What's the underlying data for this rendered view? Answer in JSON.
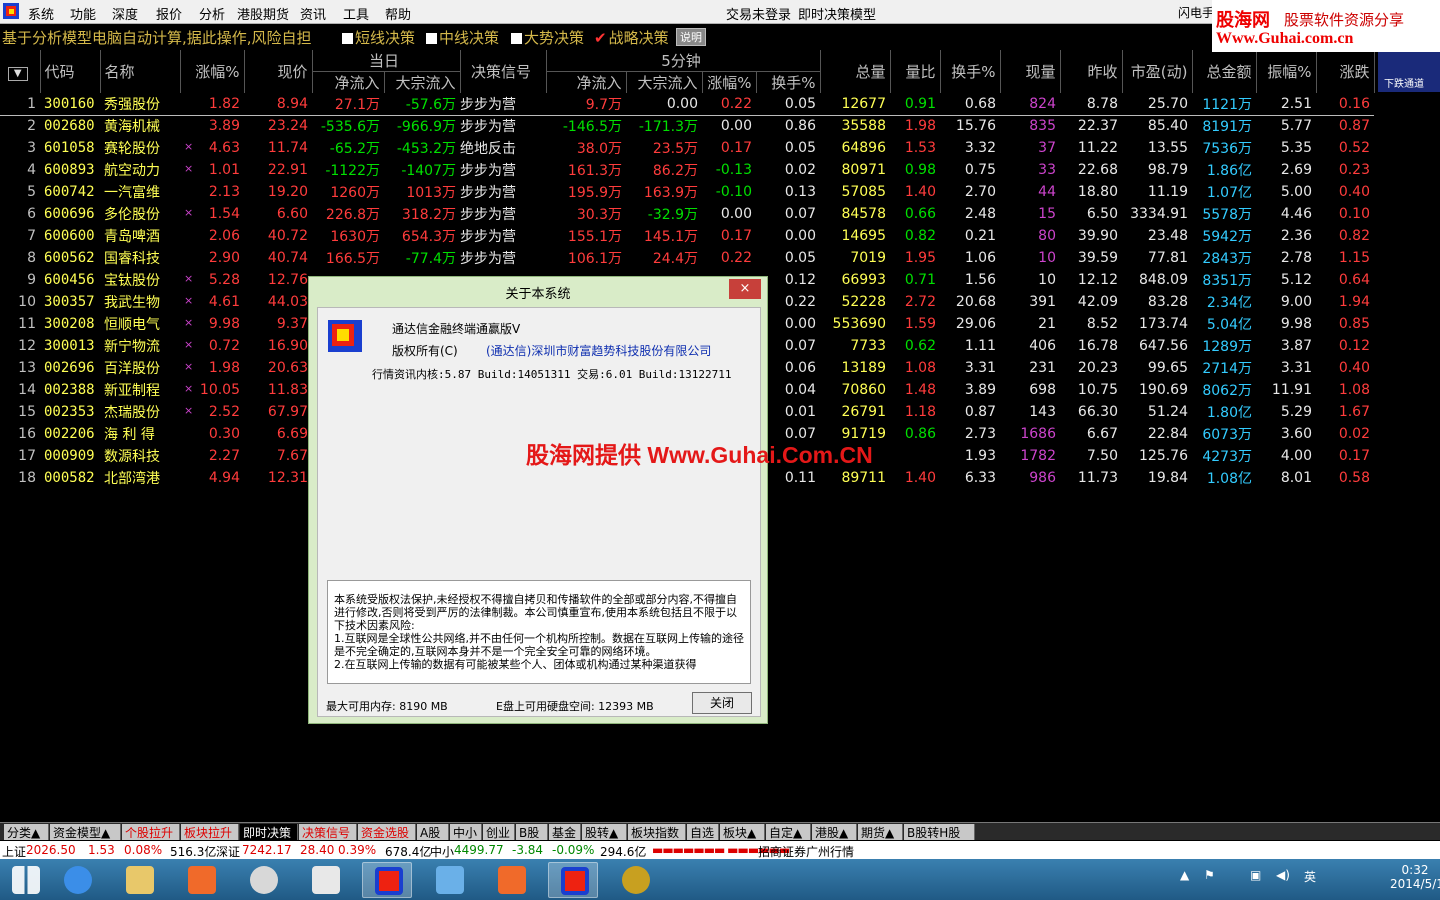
{
  "menubar": {
    "items": [
      "系统",
      "功能",
      "深度",
      "报价",
      "分析",
      "港股期货",
      "资讯",
      "工具",
      "帮助"
    ],
    "center_items": [
      "交易未登录",
      "即时决策模型"
    ],
    "right_label": "闪电手"
  },
  "brand": {
    "name": "股海网",
    "slogan": "股票软件资源分享",
    "url": "Www.Guhai.com.cn"
  },
  "subbar": {
    "info": "基于分析模型电脑自动计算,据此操作,风险自担",
    "options": [
      {
        "label": "短线决策",
        "checked": false
      },
      {
        "label": "中线决策",
        "checked": false
      },
      {
        "label": "大势决策",
        "checked": false
      },
      {
        "label": "战略决策",
        "checked": true
      }
    ],
    "help": "说明"
  },
  "drop_indicator": "下跌通道",
  "table": {
    "headers": {
      "code": "代码",
      "name": "名称",
      "chg": "涨幅%",
      "price": "现价",
      "day_group": "当日",
      "day_net": "净流入",
      "day_block": "大宗流入",
      "signal": "决策信号",
      "min5_group": "5分钟",
      "m5_net": "净流入",
      "m5_block": "大宗流入",
      "m5_chg": "涨幅%",
      "m5_turn": "换手%",
      "vol": "总量",
      "vr": "量比",
      "turn": "换手%",
      "cur": "现量",
      "prev": "昨收",
      "pe": "市盈(动)",
      "amt": "总金额",
      "amp": "振幅%",
      "up": "涨跌"
    },
    "rows": [
      {
        "i": "1",
        "code": "300160",
        "name": "秀强股份",
        "mark": "",
        "chg": "1.82",
        "price": "8.94",
        "dnet": "27.1万",
        "dblk": "-57.6万",
        "sig": "步步为营",
        "mnet": "9.7万",
        "mblk": "0.00",
        "mchg": "0.22",
        "mturn": "0.05",
        "vol": "12677",
        "vr": "0.91",
        "turn": "0.68",
        "cur": "824",
        "prev": "8.78",
        "pe": "25.70",
        "amt": "1121万",
        "amp": "2.51",
        "up": "0.16"
      },
      {
        "i": "2",
        "code": "002680",
        "name": "黄海机械",
        "mark": "",
        "chg": "3.89",
        "price": "23.24",
        "dnet": "-535.6万",
        "dblk": "-966.9万",
        "sig": "步步为营",
        "mnet": "-146.5万",
        "mblk": "-171.3万",
        "mchg": "0.00",
        "mturn": "0.86",
        "vol": "35588",
        "vr": "1.98",
        "turn": "15.76",
        "cur": "835",
        "prev": "22.37",
        "pe": "85.40",
        "amt": "8191万",
        "amp": "5.77",
        "up": "0.87"
      },
      {
        "i": "3",
        "code": "601058",
        "name": "赛轮股份",
        "mark": "×",
        "chg": "4.63",
        "price": "11.74",
        "dnet": "-65.2万",
        "dblk": "-453.2万",
        "sig": "绝地反击",
        "mnet": "38.0万",
        "mblk": "23.5万",
        "mchg": "0.17",
        "mturn": "0.05",
        "vol": "64896",
        "vr": "1.53",
        "turn": "3.32",
        "cur": "37",
        "prev": "11.22",
        "pe": "13.55",
        "amt": "7536万",
        "amp": "5.35",
        "up": "0.52"
      },
      {
        "i": "4",
        "code": "600893",
        "name": "航空动力",
        "mark": "×",
        "chg": "1.01",
        "price": "22.91",
        "dnet": "-1122万",
        "dblk": "-1407万",
        "sig": "步步为营",
        "mnet": "161.3万",
        "mblk": "86.2万",
        "mchg": "-0.13",
        "mturn": "0.02",
        "vol": "80971",
        "vr": "0.98",
        "turn": "0.75",
        "cur": "33",
        "prev": "22.68",
        "pe": "98.79",
        "amt": "1.86亿",
        "amp": "2.69",
        "up": "0.23"
      },
      {
        "i": "5",
        "code": "600742",
        "name": "一汽富维",
        "mark": "",
        "chg": "2.13",
        "price": "19.20",
        "dnet": "1260万",
        "dblk": "1013万",
        "sig": "步步为营",
        "mnet": "195.9万",
        "mblk": "163.9万",
        "mchg": "-0.10",
        "mturn": "0.13",
        "vol": "57085",
        "vr": "1.40",
        "turn": "2.70",
        "cur": "44",
        "prev": "18.80",
        "pe": "11.19",
        "amt": "1.07亿",
        "amp": "5.00",
        "up": "0.40"
      },
      {
        "i": "6",
        "code": "600696",
        "name": "多伦股份",
        "mark": "×",
        "chg": "1.54",
        "price": "6.60",
        "dnet": "226.8万",
        "dblk": "318.2万",
        "sig": "步步为营",
        "mnet": "30.3万",
        "mblk": "-32.9万",
        "mchg": "0.00",
        "mturn": "0.07",
        "vol": "84578",
        "vr": "0.66",
        "turn": "2.48",
        "cur": "15",
        "prev": "6.50",
        "pe": "3334.91",
        "amt": "5578万",
        "amp": "4.46",
        "up": "0.10"
      },
      {
        "i": "7",
        "code": "600600",
        "name": "青岛啤酒",
        "mark": "",
        "chg": "2.06",
        "price": "40.72",
        "dnet": "1630万",
        "dblk": "654.3万",
        "sig": "步步为营",
        "mnet": "155.1万",
        "mblk": "145.1万",
        "mchg": "0.17",
        "mturn": "0.00",
        "vol": "14695",
        "vr": "0.82",
        "turn": "0.21",
        "cur": "80",
        "prev": "39.90",
        "pe": "23.48",
        "amt": "5942万",
        "amp": "2.36",
        "up": "0.82"
      },
      {
        "i": "8",
        "code": "600562",
        "name": "国睿科技",
        "mark": "",
        "chg": "2.90",
        "price": "40.74",
        "dnet": "166.5万",
        "dblk": "-77.4万",
        "sig": "步步为营",
        "mnet": "106.1万",
        "mblk": "24.4万",
        "mchg": "0.22",
        "mturn": "0.05",
        "vol": "7019",
        "vr": "1.95",
        "turn": "1.06",
        "cur": "10",
        "prev": "39.59",
        "pe": "77.81",
        "amt": "2843万",
        "amp": "2.78",
        "up": "1.15"
      },
      {
        "i": "9",
        "code": "600456",
        "name": "宝钛股份",
        "mark": "×",
        "chg": "5.28",
        "price": "12.76",
        "mturn": "0.12",
        "vol": "66993",
        "vr": "0.71",
        "turn": "1.56",
        "cur": "10",
        "prev": "12.12",
        "pe": "848.09",
        "amt": "8351万",
        "amp": "5.12",
        "up": "0.64"
      },
      {
        "i": "10",
        "code": "300357",
        "name": "我武生物",
        "mark": "×",
        "chg": "4.61",
        "price": "44.03",
        "mturn": "0.22",
        "vol": "52228",
        "vr": "2.72",
        "turn": "20.68",
        "cur": "391",
        "prev": "42.09",
        "pe": "83.28",
        "amt": "2.34亿",
        "amp": "9.00",
        "up": "1.94"
      },
      {
        "i": "11",
        "code": "300208",
        "name": "恒顺电气",
        "mark": "×",
        "chg": "9.98",
        "price": "9.37",
        "mturn": "0.00",
        "vol": "553690",
        "vr": "1.59",
        "turn": "29.06",
        "cur": "21",
        "prev": "8.52",
        "pe": "173.74",
        "amt": "5.04亿",
        "amp": "9.98",
        "up": "0.85"
      },
      {
        "i": "12",
        "code": "300013",
        "name": "新宁物流",
        "mark": "×",
        "chg": "0.72",
        "price": "16.90",
        "mturn": "0.07",
        "vol": "7733",
        "vr": "0.62",
        "turn": "1.11",
        "cur": "406",
        "prev": "16.78",
        "pe": "647.56",
        "amt": "1289万",
        "amp": "3.87",
        "up": "0.12"
      },
      {
        "i": "13",
        "code": "002696",
        "name": "百洋股份",
        "mark": "×",
        "chg": "1.98",
        "price": "20.63",
        "mturn": "0.06",
        "vol": "13189",
        "vr": "1.08",
        "turn": "3.31",
        "cur": "231",
        "prev": "20.23",
        "pe": "99.65",
        "amt": "2714万",
        "amp": "3.31",
        "up": "0.40"
      },
      {
        "i": "14",
        "code": "002388",
        "name": "新亚制程",
        "mark": "×",
        "chg": "10.05",
        "price": "11.83",
        "mturn": "0.04",
        "vol": "70860",
        "vr": "1.48",
        "turn": "3.89",
        "cur": "698",
        "prev": "10.75",
        "pe": "190.69",
        "amt": "8062万",
        "amp": "11.91",
        "up": "1.08"
      },
      {
        "i": "15",
        "code": "002353",
        "name": "杰瑞股份",
        "mark": "×",
        "chg": "2.52",
        "price": "67.97",
        "mturn": "0.01",
        "vol": "26791",
        "vr": "1.18",
        "turn": "0.87",
        "cur": "143",
        "prev": "66.30",
        "pe": "51.24",
        "amt": "1.80亿",
        "amp": "5.29",
        "up": "1.67"
      },
      {
        "i": "16",
        "code": "002206",
        "name": "海 利 得",
        "mark": "",
        "chg": "0.30",
        "price": "6.69",
        "mturn": "0.07",
        "vol": "91719",
        "vr": "0.86",
        "turn": "2.73",
        "cur": "1686",
        "prev": "6.67",
        "pe": "22.84",
        "amt": "6073万",
        "amp": "3.60",
        "up": "0.02"
      },
      {
        "i": "17",
        "code": "000909",
        "name": "数源科技",
        "mark": "",
        "chg": "2.27",
        "price": "7.67",
        "mturn": "",
        "vol": "",
        "vr": "",
        "turn": "1.93",
        "cur": "1782",
        "prev": "7.50",
        "pe": "125.76",
        "amt": "4273万",
        "amp": "4.00",
        "up": "0.17"
      },
      {
        "i": "18",
        "code": "000582",
        "name": "北部湾港",
        "mark": "",
        "chg": "4.94",
        "price": "12.31",
        "mturn": "0.11",
        "vol": "89711",
        "vr": "1.40",
        "turn": "6.33",
        "cur": "986",
        "prev": "11.73",
        "pe": "19.84",
        "amt": "1.08亿",
        "amp": "8.01",
        "up": "0.58"
      }
    ]
  },
  "dialog": {
    "title": "关于本系统",
    "close_x": "×",
    "product": "通达信金融终端通赢版V",
    "copyright_label": "版权所有(C)",
    "company": "(通达信)深圳市财富趋势科技股份有限公司",
    "build": "行情资讯内核:5.87 Build:14051311 交易:6.01 Build:13122711",
    "legal": "本系统受版权法保护,未经授权不得擅自拷贝和传播软件的全部或部分内容,不得擅自进行修改,否则将受到严厉的法律制裁。本公司慎重宣布,使用本系统包括且不限于以下技术因素风险:\n1.互联网是全球性公共网络,并不由任何一个机构所控制。数据在互联网上传输的途径是不完全确定的,互联网本身并不是一个完全安全可靠的网络环境。\n2.在互联网上传输的数据有可能被某些个人、团体或机构通过某种渠道获得",
    "mem": "最大可用内存: 8190 MB",
    "disk": "E盘上可用硬盘空间: 12393 MB",
    "ok": "关闭"
  },
  "watermark": "股海网提供 Www.Guhai.Com.CN",
  "bottomtabs": [
    "分类▲",
    "资金模型▲",
    "个股拉升",
    "板块拉升",
    "即时决策",
    "决策信号",
    "资金选股",
    "A股",
    "中小",
    "创业",
    "B股",
    "基金",
    "股转▲",
    "板块指数",
    "自选",
    "板块▲",
    "自定▲",
    "港股▲",
    "期货▲",
    "B股转H股"
  ],
  "status": {
    "sh_label": "上证",
    "sh": "2026.50",
    "sh_chg": "1.53",
    "sh_pct": "0.08%",
    "sh_amt": "516.3亿",
    "sz_label": "深证",
    "sz": "7242.17",
    "sz_chg": "28.40",
    "sz_pct": "0.39%",
    "sz_amt": "678.4亿",
    "zx_label": "中小",
    "zx": "4499.77",
    "zx_chg": "-3.84",
    "zx_pct": "-0.09%",
    "zx_amt": "294.6亿",
    "broker": "招商证券广州行情"
  },
  "tray": {
    "ime": "英",
    "time": "0:32",
    "date": "2014/5/18"
  }
}
